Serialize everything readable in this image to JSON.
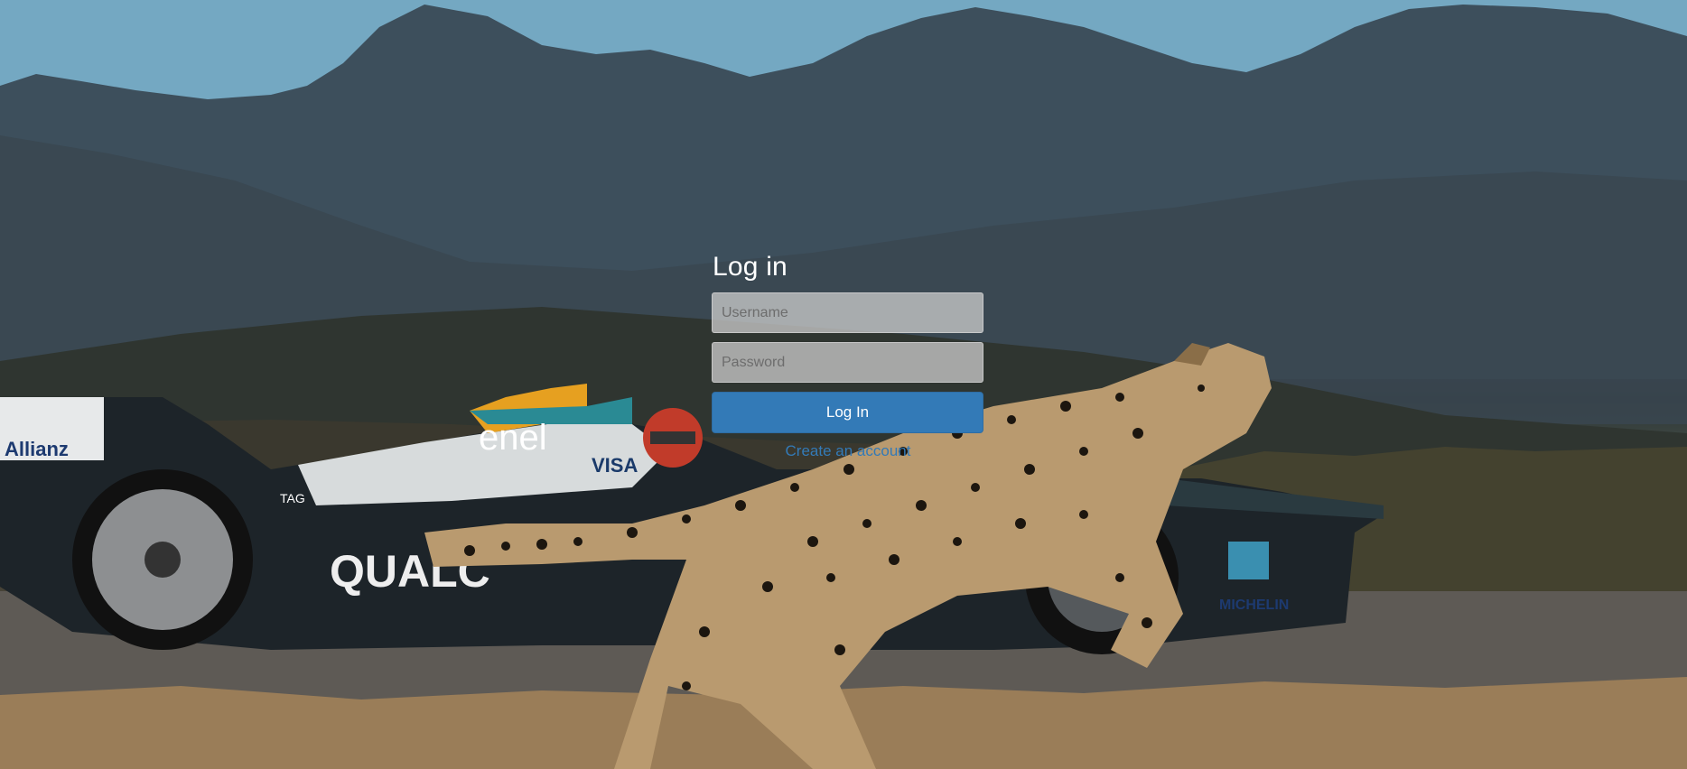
{
  "login": {
    "title": "Log in",
    "username_placeholder": "Username",
    "password_placeholder": "Password",
    "login_button_label": "Log In",
    "create_account_label": "Create an account"
  },
  "background": {
    "scene": "photo-background",
    "car_sponsor_labels": [
      "enel",
      "VISA",
      "QUALC",
      "MICHELIN",
      "Allianz",
      "TAG"
    ]
  },
  "colors": {
    "primary_button": "#337ab7",
    "link": "#337ab7",
    "title_text": "#ffffff"
  }
}
